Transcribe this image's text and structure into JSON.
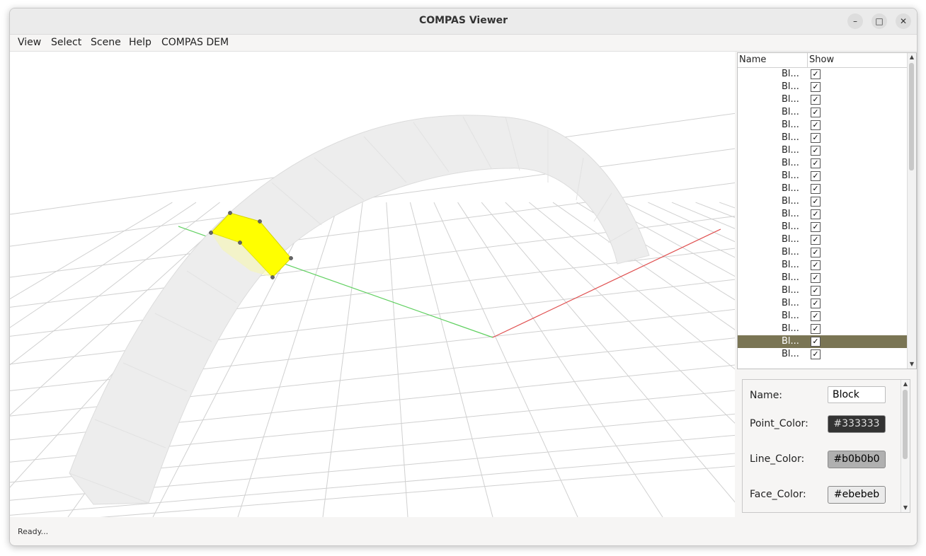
{
  "window": {
    "title": "COMPAS Viewer",
    "controls": {
      "minimize": "–",
      "maximize": "□",
      "close": "✕"
    }
  },
  "menu": [
    "View",
    "Select",
    "Scene",
    "Help",
    "COMPAS DEM"
  ],
  "tree": {
    "headers": {
      "name": "Name",
      "show": "Show"
    },
    "check_glyph": "✓",
    "rows": [
      {
        "label": "Bl...",
        "checked": true,
        "selected": false
      },
      {
        "label": "Bl...",
        "checked": true,
        "selected": false
      },
      {
        "label": "Bl...",
        "checked": true,
        "selected": false
      },
      {
        "label": "Bl...",
        "checked": true,
        "selected": false
      },
      {
        "label": "Bl...",
        "checked": true,
        "selected": false
      },
      {
        "label": "Bl...",
        "checked": true,
        "selected": false
      },
      {
        "label": "Bl...",
        "checked": true,
        "selected": false
      },
      {
        "label": "Bl...",
        "checked": true,
        "selected": false
      },
      {
        "label": "Bl...",
        "checked": true,
        "selected": false
      },
      {
        "label": "Bl...",
        "checked": true,
        "selected": false
      },
      {
        "label": "Bl...",
        "checked": true,
        "selected": false
      },
      {
        "label": "Bl...",
        "checked": true,
        "selected": false
      },
      {
        "label": "Bl...",
        "checked": true,
        "selected": false
      },
      {
        "label": "Bl...",
        "checked": true,
        "selected": false
      },
      {
        "label": "Bl...",
        "checked": true,
        "selected": false
      },
      {
        "label": "Bl...",
        "checked": true,
        "selected": false
      },
      {
        "label": "Bl...",
        "checked": true,
        "selected": false
      },
      {
        "label": "Bl...",
        "checked": true,
        "selected": false
      },
      {
        "label": "Bl...",
        "checked": true,
        "selected": false
      },
      {
        "label": "Bl...",
        "checked": true,
        "selected": false
      },
      {
        "label": "Bl...",
        "checked": true,
        "selected": false
      },
      {
        "label": "Bl...",
        "checked": true,
        "selected": true
      },
      {
        "label": "Bl...",
        "checked": true,
        "selected": false
      }
    ]
  },
  "properties": {
    "name_label": "Name:",
    "name_value": "Block",
    "point_color_label": "Point_Color:",
    "point_color": "#333333",
    "line_color_label": "Line_Color:",
    "line_color": "#b0b0b0",
    "face_color_label": "Face_Color:",
    "face_color": "#ebebeb"
  },
  "status": "Ready...",
  "colors": {
    "x_axis": "#e05050",
    "y_axis": "#60d060",
    "grid": "#d0d0d0",
    "highlight": "#ffff00",
    "selected_row": "#7a7554"
  }
}
